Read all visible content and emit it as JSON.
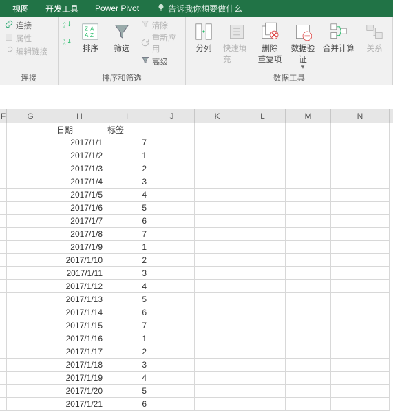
{
  "colors": {
    "brand": "#217346"
  },
  "tabs": {
    "view": "视图",
    "dev": "开发工具",
    "pivot": "Power Pivot"
  },
  "tellme": {
    "placeholder": "告诉我你想要做什么"
  },
  "ribbon": {
    "connections": {
      "connect": "连接",
      "properties": "属性",
      "editlinks": "编辑链接",
      "label": "连接"
    },
    "sortfilter": {
      "sort": "排序",
      "filter": "筛选",
      "clear": "清除",
      "reapply": "重新应用",
      "advanced": "高级",
      "label": "排序和筛选"
    },
    "datatools": {
      "split": "分列",
      "flash": "快速填充",
      "dedup": "删除\n重复项",
      "valid": "数据验\n证",
      "consol": "合并计算",
      "rel": "关系",
      "label": "数据工具"
    }
  },
  "sheet": {
    "columns": [
      "F",
      "G",
      "H",
      "I",
      "J",
      "K",
      "L",
      "M",
      "N"
    ],
    "header": {
      "H": "日期",
      "I": "标签"
    },
    "rows": [
      {
        "H": "2017/1/1",
        "I": "7"
      },
      {
        "H": "2017/1/2",
        "I": "1"
      },
      {
        "H": "2017/1/3",
        "I": "2"
      },
      {
        "H": "2017/1/4",
        "I": "3"
      },
      {
        "H": "2017/1/5",
        "I": "4"
      },
      {
        "H": "2017/1/6",
        "I": "5"
      },
      {
        "H": "2017/1/7",
        "I": "6"
      },
      {
        "H": "2017/1/8",
        "I": "7"
      },
      {
        "H": "2017/1/9",
        "I": "1"
      },
      {
        "H": "2017/1/10",
        "I": "2"
      },
      {
        "H": "2017/1/11",
        "I": "3"
      },
      {
        "H": "2017/1/12",
        "I": "4"
      },
      {
        "H": "2017/1/13",
        "I": "5"
      },
      {
        "H": "2017/1/14",
        "I": "6"
      },
      {
        "H": "2017/1/15",
        "I": "7"
      },
      {
        "H": "2017/1/16",
        "I": "1"
      },
      {
        "H": "2017/1/17",
        "I": "2"
      },
      {
        "H": "2017/1/18",
        "I": "3"
      },
      {
        "H": "2017/1/19",
        "I": "4"
      },
      {
        "H": "2017/1/20",
        "I": "5"
      },
      {
        "H": "2017/1/21",
        "I": "6"
      }
    ]
  }
}
